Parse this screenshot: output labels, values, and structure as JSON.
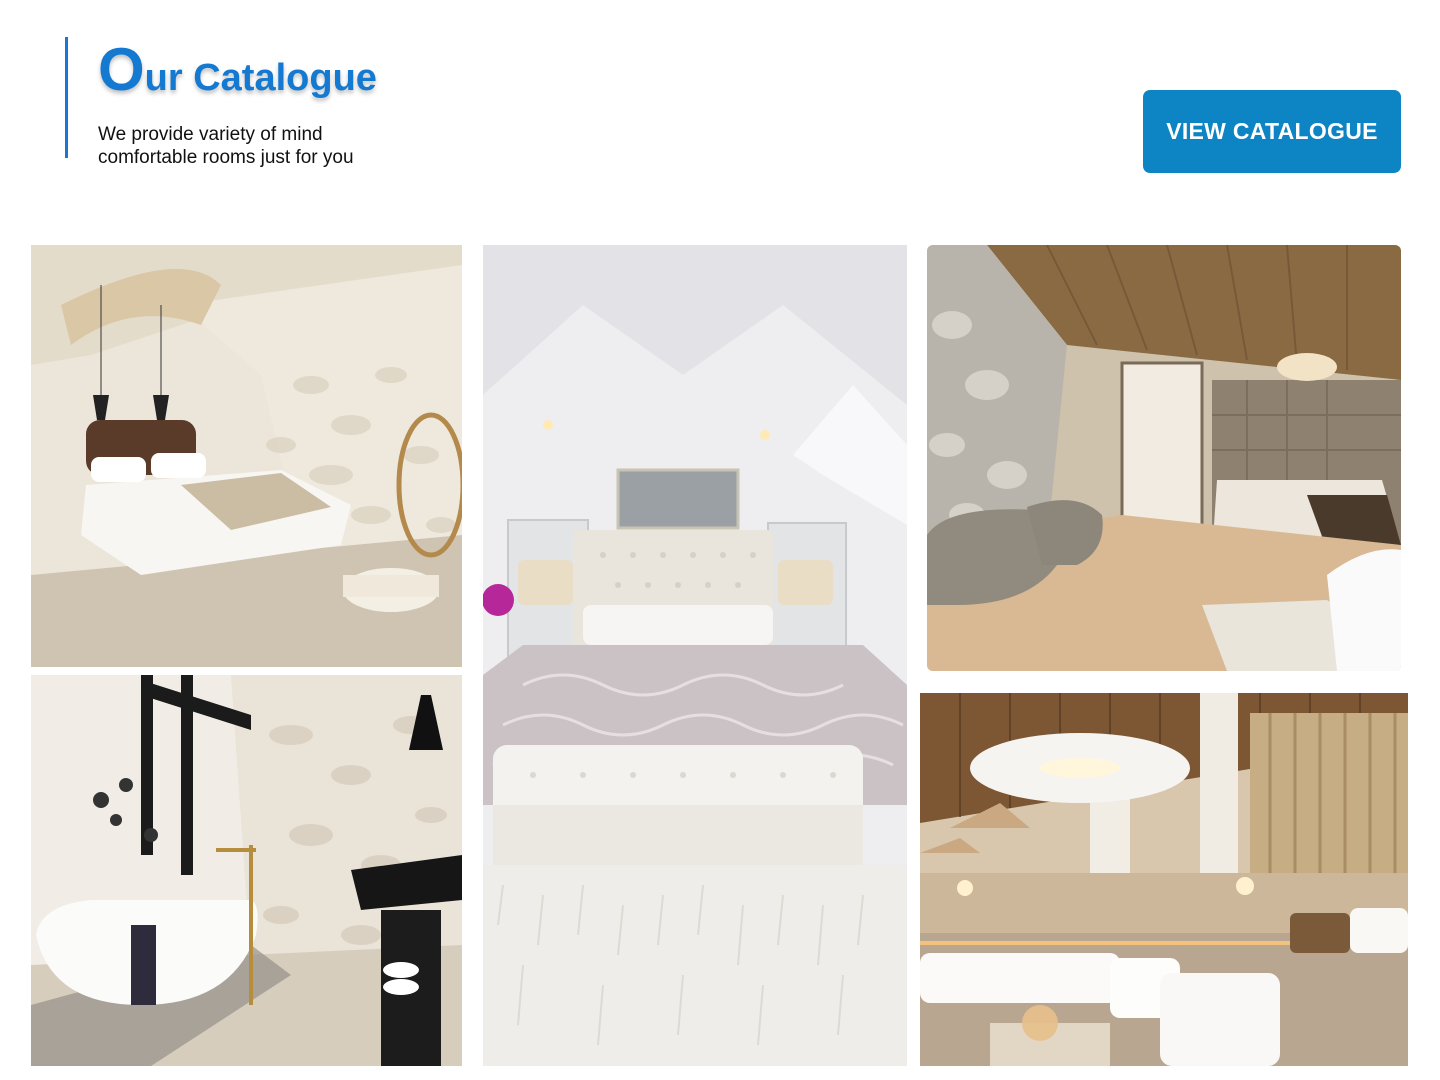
{
  "header": {
    "title_initial": "O",
    "title_rest": "ur Catalogue",
    "subtitle": "We provide variety of mind comfortable rooms just for you",
    "accent_color": "#1479d1"
  },
  "cta": {
    "label": "VIEW CATALOGUE",
    "color": "#0d84c4"
  },
  "gallery": {
    "photos": [
      {
        "subject": "white stone-wall bedroom with hanging rattan chair"
      },
      {
        "subject": "stone-wall bathroom with freestanding tub and black sink"
      },
      {
        "subject": "attic bedroom with tufted headboard and shag rug"
      },
      {
        "subject": "wood-ceiling suite with stone bathtubs"
      },
      {
        "subject": "hotel lounge with white sofas and wooden ceiling"
      }
    ]
  }
}
